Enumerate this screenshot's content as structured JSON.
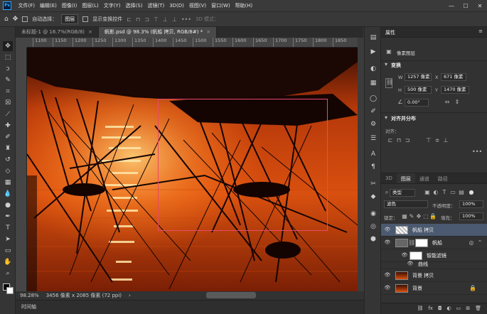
{
  "menubar": {
    "app_logo": "Ps",
    "items": [
      "文件(F)",
      "编辑(E)",
      "图像(I)",
      "图层(L)",
      "文字(Y)",
      "选择(S)",
      "滤镜(T)",
      "3D(D)",
      "视图(V)",
      "窗口(W)",
      "帮助(H)"
    ],
    "window_buttons": [
      "—",
      "☐",
      "✕"
    ]
  },
  "options": {
    "auto_select_label": "自动选择：",
    "auto_select_value": "图层",
    "show_transform_label": "显示变换控件",
    "mode_3d_label": "3D 模式："
  },
  "tabs": [
    {
      "label": "未标题-1 @ 16.7%(RGB/8)",
      "close": "×",
      "active": false
    },
    {
      "label": "帆影.psd @ 98.3% (帆船 拷贝, RGB/8#) *",
      "close": "×",
      "active": true
    }
  ],
  "ruler": {
    "ticks": [
      "1100",
      "1150",
      "1200",
      "1250",
      "1300",
      "1350",
      "1400",
      "1450",
      "1500",
      "1550",
      "1600",
      "1650",
      "1700",
      "1750",
      "1800",
      "1850"
    ]
  },
  "status": {
    "zoom": "98.28%",
    "doc_info": "3456 像素 x 2085 像素 (72 ppi)",
    "arrow": "›"
  },
  "timeline": {
    "label": "时间轴"
  },
  "properties": {
    "title": "属性",
    "layer_type": "像素图层",
    "transform_title": "变换",
    "w_label": "W",
    "w_value": "1257 像素",
    "x_label": "X",
    "x_value": "671 像素",
    "h_label": "H",
    "h_value": "500 像素",
    "y_label": "Y",
    "y_value": "1470 像素",
    "angle_value": "0.00°",
    "align_title": "对齐并分布",
    "align_label": "对齐："
  },
  "layers_panel": {
    "tabs": [
      {
        "label": "3D",
        "active": false
      },
      {
        "label": "图层",
        "active": true
      },
      {
        "label": "通道",
        "active": false
      },
      {
        "label": "路径",
        "active": false
      }
    ],
    "filter_value": "类型",
    "blend_mode": "滤色",
    "opacity_label": "不透明度：",
    "opacity_value": "100%",
    "lock_label": "锁定：",
    "fill_label": "填充：",
    "fill_value": "100%",
    "layers": [
      {
        "name": "帆船 拷贝",
        "selected": true
      },
      {
        "name": "帆船",
        "selected": false
      },
      {
        "name": "智能滤镜",
        "selected": false
      },
      {
        "name": "曲线",
        "selected": false
      },
      {
        "name": "背景 拷贝",
        "selected": false
      },
      {
        "name": "背景",
        "selected": false
      }
    ]
  },
  "colors": {
    "accent": "#31a8ff",
    "selection_outline": "#e84a6a",
    "sunset_orange": "#c0390a",
    "layer_selected": "#4b5a70"
  }
}
